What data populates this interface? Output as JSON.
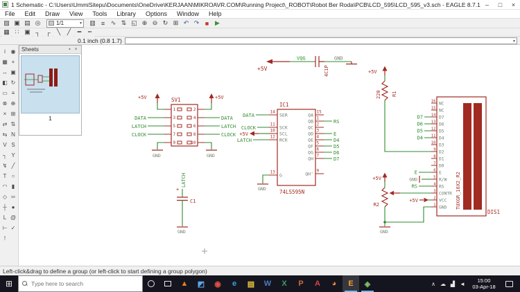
{
  "window": {
    "title": "1 Schematic - C:\\Users\\UmmiSitepu\\Documents\\OneDrive\\KERJAAN\\MIKROAVR.COM\\Running Project\\_ROBOT\\Robot Ber Roda\\PCB\\LCD_595\\LCD_595_v3.sch - EAGLE 8.7.1 free",
    "minimize": "–",
    "maximize": "□",
    "close": "×"
  },
  "menubar": {
    "items": [
      "File",
      "Edit",
      "Draw",
      "View",
      "Tools",
      "Library",
      "Options",
      "Window",
      "Help"
    ]
  },
  "toolbar1": {
    "layer_value": "1/1",
    "dropdown_arrow": "▾",
    "icons_a": [
      {
        "name": "open-icon",
        "glyph": "▨"
      },
      {
        "name": "save-icon",
        "glyph": "▣"
      },
      {
        "name": "print-icon",
        "glyph": "▤"
      },
      {
        "name": "cam-processor-icon",
        "glyph": "◎"
      }
    ],
    "icons_b": [
      {
        "name": "board-switch-icon",
        "glyph": "▥"
      },
      {
        "name": "library-icon",
        "glyph": "≡"
      },
      {
        "name": "run-script-icon",
        "glyph": "∿"
      },
      {
        "name": "sync-icon",
        "glyph": "⇅"
      },
      {
        "name": "zoom-fit-icon",
        "glyph": "◱"
      },
      {
        "name": "zoom-in-icon",
        "glyph": "⊕"
      },
      {
        "name": "zoom-out-icon",
        "glyph": "⊖"
      },
      {
        "name": "zoom-redraw-icon",
        "glyph": "↻"
      },
      {
        "name": "zoom-select-icon",
        "glyph": "⊞"
      },
      {
        "name": "undo-icon",
        "glyph": "↶",
        "color": "#2e62a8"
      },
      {
        "name": "redo-icon",
        "glyph": "↷",
        "color": "#2e62a8"
      },
      {
        "name": "stop-icon",
        "glyph": "■",
        "color": "#c0392e"
      },
      {
        "name": "go-icon",
        "glyph": "▶",
        "color": "#3d8f3d"
      }
    ]
  },
  "toolbar2": {
    "icons": [
      {
        "name": "grid-icon",
        "glyph": "▦"
      },
      {
        "name": "dot-grid-icon",
        "glyph": "∷"
      },
      {
        "name": "pad-icon",
        "glyph": "▣"
      },
      {
        "name": "bend-right-icon",
        "glyph": "┐"
      },
      {
        "name": "bend-left-icon",
        "glyph": "┌"
      },
      {
        "name": "bend-diag-down-icon",
        "glyph": "╲"
      },
      {
        "name": "bend-diag-up-icon",
        "glyph": "╱"
      },
      {
        "name": "width-icon",
        "glyph": "━"
      },
      {
        "name": "line-style-icon",
        "glyph": "┅"
      }
    ]
  },
  "coordbar": {
    "coords": "0.1 inch (0.8 1.7)",
    "combo_arrow": "▾"
  },
  "sheets": {
    "title": "Sheets",
    "pin_icon": "▪",
    "close_icon": "×",
    "sheet_label": "1"
  },
  "tools": [
    {
      "name": "info-tool",
      "glyph": "i"
    },
    {
      "name": "show-tool",
      "glyph": "◉"
    },
    {
      "name": "display-tool",
      "glyph": "▦"
    },
    {
      "name": "mark-tool",
      "glyph": "+"
    },
    {
      "name": "move-tool",
      "glyph": "↔"
    },
    {
      "name": "copy-tool",
      "glyph": "▣"
    },
    {
      "name": "mirror-tool",
      "glyph": "◧"
    },
    {
      "name": "rotate-tool",
      "glyph": "↻"
    },
    {
      "name": "group-tool",
      "glyph": "▭"
    },
    {
      "name": "change-tool",
      "glyph": "≡"
    },
    {
      "name": "cut-tool",
      "glyph": "⊗"
    },
    {
      "name": "paste-tool",
      "glyph": "⊕"
    },
    {
      "name": "delete-tool",
      "glyph": "×"
    },
    {
      "name": "add-tool",
      "glyph": "⊞"
    },
    {
      "name": "pinswap-tool",
      "glyph": "⇄"
    },
    {
      "name": "gateswap-tool",
      "glyph": "⇅"
    },
    {
      "name": "replace-tool",
      "glyph": "⇆"
    },
    {
      "name": "name-tool",
      "glyph": "N"
    },
    {
      "name": "value-tool",
      "glyph": "V"
    },
    {
      "name": "smash-tool",
      "glyph": "S"
    },
    {
      "name": "miter-tool",
      "glyph": "┐"
    },
    {
      "name": "split-tool",
      "glyph": "Y"
    },
    {
      "name": "invoke-tool",
      "glyph": "↯"
    },
    {
      "name": "wire-tool",
      "glyph": "╱"
    },
    {
      "name": "text-tool",
      "glyph": "T"
    },
    {
      "name": "circle-tool",
      "glyph": "○"
    },
    {
      "name": "arc-tool",
      "glyph": "◠"
    },
    {
      "name": "rect-tool",
      "glyph": "▮"
    },
    {
      "name": "polygon-tool",
      "glyph": "◇"
    },
    {
      "name": "bus-tool",
      "glyph": "═"
    },
    {
      "name": "net-tool",
      "glyph": "┼"
    },
    {
      "name": "junction-tool",
      "glyph": "●"
    },
    {
      "name": "label-tool",
      "glyph": "L"
    },
    {
      "name": "attribute-tool",
      "glyph": "@"
    },
    {
      "name": "dimension-tool",
      "glyph": "⊢"
    },
    {
      "name": "erc-tool",
      "glyph": "✓"
    },
    {
      "name": "errors-tool",
      "glyph": "!"
    }
  ],
  "statusbar": {
    "text": "Left-click&drag to define a group (or left-click to start defining a group polygon)"
  },
  "taskbar": {
    "start_glyph": "⊞",
    "search_placeholder": "Type here to search",
    "active_app": "eagle-icon",
    "apps": [
      {
        "name": "vlc-icon",
        "glyph": "▲",
        "color": "#e87f1e"
      },
      {
        "name": "photos-icon",
        "glyph": "◩",
        "color": "#5aa7e8"
      },
      {
        "name": "chrome-icon",
        "glyph": "◉",
        "color": "#de5145"
      },
      {
        "name": "edge-icon",
        "glyph": "e",
        "color": "#3aa3dd"
      },
      {
        "name": "file-explorer-icon",
        "glyph": "▤",
        "color": "#e9c63f"
      },
      {
        "name": "word-icon",
        "glyph": "W",
        "color": "#4a7cc7"
      },
      {
        "name": "excel-icon",
        "glyph": "X",
        "color": "#3f9e5f"
      },
      {
        "name": "powerpoint-icon",
        "glyph": "P",
        "color": "#d4683c"
      },
      {
        "name": "acrobat-icon",
        "glyph": "A",
        "color": "#d64545"
      },
      {
        "name": "firefox-icon",
        "glyph": "◕",
        "color": "#e88b3a"
      },
      {
        "name": "eagle-icon",
        "glyph": "E",
        "color": "#f0a030"
      },
      {
        "name": "eagle-control-panel-icon",
        "glyph": "◈",
        "color": "#7fc063"
      }
    ],
    "tray": [
      {
        "name": "chevron-up-icon",
        "glyph": "∧"
      },
      {
        "name": "cloud-icon",
        "glyph": "☁"
      },
      {
        "name": "network-icon",
        "glyph": "▟"
      },
      {
        "name": "volume-icon",
        "glyph": "◄"
      }
    ],
    "time": "15:00",
    "date": "03-Apr-18"
  },
  "schematic": {
    "colors": {
      "symbol_red": "#a12a21",
      "net_green": "#2f8a2f",
      "pin_text_grey": "#6e7d6e",
      "canvas": "#ffffff"
    },
    "supply": {
      "p5v": "+5V",
      "gnd": "GND"
    },
    "cap_top": {
      "net_left": "VQG",
      "name_vertical": "4C1P",
      "net_right": "GND"
    },
    "sv1": {
      "name": "SV1",
      "pins_left": [
        "1",
        "3",
        "5",
        "7",
        "9"
      ],
      "pins_right": [
        "2",
        "4",
        "6",
        "8",
        "10"
      ],
      "nets": {
        "data": "DATA",
        "latch": "LATCH",
        "clock": "CLOCK"
      }
    },
    "ic1": {
      "name": "IC1",
      "value": "74LS595N",
      "pins_left": [
        {
          "num": "14",
          "name": "SER",
          "net": "DATA"
        },
        {
          "num": "11",
          "name": "SCK",
          "net": "CLOCK"
        },
        {
          "num": "10",
          "name": "SCL",
          "net": "+5V"
        },
        {
          "num": "12",
          "name": "RCK",
          "net": "LATCH"
        },
        {
          "num": "13",
          "name": "G",
          "net": "GND"
        }
      ],
      "pins_right": [
        {
          "num": "15",
          "name": "QA",
          "net": ""
        },
        {
          "num": "1",
          "name": "QB",
          "net": "RS"
        },
        {
          "num": "2",
          "name": "QC",
          "net": ""
        },
        {
          "num": "3",
          "name": "QD",
          "net": "E"
        },
        {
          "num": "4",
          "name": "QE",
          "net": "D4"
        },
        {
          "num": "5",
          "name": "QF",
          "net": "D5"
        },
        {
          "num": "6",
          "name": "QG",
          "net": "D6"
        },
        {
          "num": "7",
          "name": "QH",
          "net": "D7"
        },
        {
          "num": "9",
          "name": "QH'",
          "net": ""
        }
      ]
    },
    "c1": {
      "name": "C1",
      "net": "LATCH",
      "plus": "+"
    },
    "r1": {
      "name": "R1",
      "value": "220"
    },
    "r2": {
      "name": "R2"
    },
    "lcd": {
      "name": "DIS1",
      "value": "TUXGR_16X2_R2",
      "pins": [
        {
          "num": "16",
          "name": "NC"
        },
        {
          "num": "15",
          "name": "NC"
        },
        {
          "num": "14",
          "name": "D7"
        },
        {
          "num": "13",
          "name": "D6"
        },
        {
          "num": "12",
          "name": "D5"
        },
        {
          "num": "11",
          "name": "D4"
        },
        {
          "num": "10",
          "name": "D3"
        },
        {
          "num": "9",
          "name": "D2"
        },
        {
          "num": "8",
          "name": "D1"
        },
        {
          "num": "7",
          "name": "D0"
        },
        {
          "num": "6",
          "name": "E"
        },
        {
          "num": "5",
          "name": "R/W"
        },
        {
          "num": "4",
          "name": "RS"
        },
        {
          "num": "3",
          "name": "CONTR"
        },
        {
          "num": "2",
          "name": "VCC"
        },
        {
          "num": "1",
          "name": "GND"
        }
      ],
      "net_labels": {
        "d7": "D7",
        "d6": "D6",
        "d5": "D5",
        "d4": "D4",
        "e": "E",
        "rs": "RS"
      }
    }
  }
}
